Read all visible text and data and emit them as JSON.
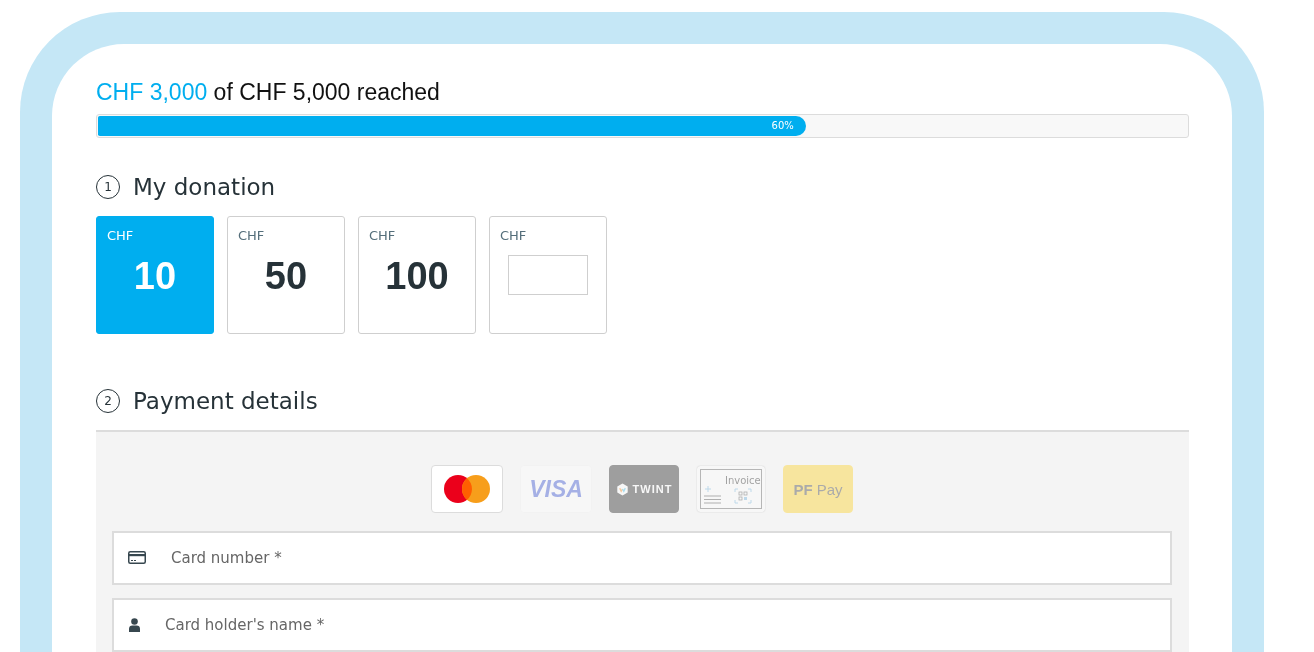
{
  "progress": {
    "raised": "CHF 3,000",
    "text": "of CHF 5,000 reached",
    "level": 0.65,
    "percent_label": "60%"
  },
  "donation": {
    "step": "1",
    "title": "My donation",
    "options": [
      {
        "kind": "preset",
        "currency": "CHF",
        "amount": "10",
        "selected": true
      },
      {
        "kind": "preset",
        "currency": "CHF",
        "amount": "50",
        "selected": false
      },
      {
        "kind": "preset",
        "currency": "CHF",
        "amount": "100",
        "selected": false
      },
      {
        "kind": "custom",
        "currency": "CHF",
        "selected": false
      }
    ]
  },
  "payment": {
    "step": "2",
    "title": "Payment details",
    "methods": [
      {
        "kind": "mastercard",
        "selected": true
      },
      {
        "kind": "visa",
        "label": "VISA",
        "selected": false
      },
      {
        "kind": "twint",
        "label": "TWINT",
        "selected": false
      },
      {
        "kind": "invoice",
        "label": "Invoice",
        "selected": false
      },
      {
        "kind": "postfinance",
        "label": "**PF** Pay",
        "selected": false
      }
    ],
    "fields": [
      {
        "kind": "card",
        "placeholder": "Card number *"
      },
      {
        "kind": "person",
        "placeholder": "Card holder's name *"
      }
    ]
  }
}
